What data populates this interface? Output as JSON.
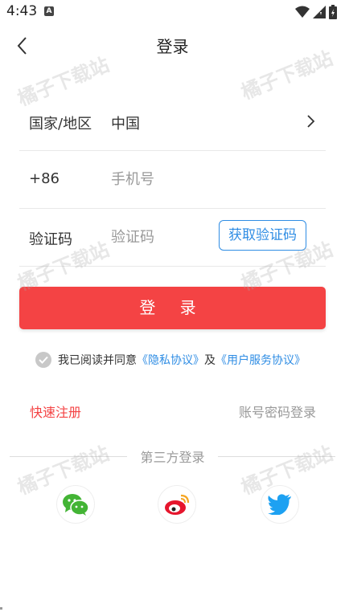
{
  "status_bar": {
    "time": "4:43",
    "notification_icon": "A"
  },
  "header": {
    "title": "登录"
  },
  "form": {
    "region": {
      "label": "国家/地区",
      "value": "中国"
    },
    "phone": {
      "prefix": "+86",
      "placeholder": "手机号"
    },
    "code": {
      "label": "验证码",
      "placeholder": "验证码",
      "button": "获取验证码"
    }
  },
  "login_button": "登 录",
  "agreement": {
    "prefix": "我已阅读并同意",
    "privacy": "《隐私协议》",
    "conj": "及",
    "service": "《用户服务协议》"
  },
  "links": {
    "quick_register": "快速注册",
    "password_login": "账号密码登录"
  },
  "third_party": {
    "title": "第三方登录",
    "providers": [
      "wechat-icon",
      "weibo-icon",
      "twitter-icon"
    ]
  },
  "watermark": "橘子下载站",
  "colors": {
    "accent_red": "#f44344",
    "link_blue": "#2f8de4",
    "wechat_green": "#43b435",
    "weibo_red": "#e6162d",
    "twitter_blue": "#1da1f2"
  }
}
